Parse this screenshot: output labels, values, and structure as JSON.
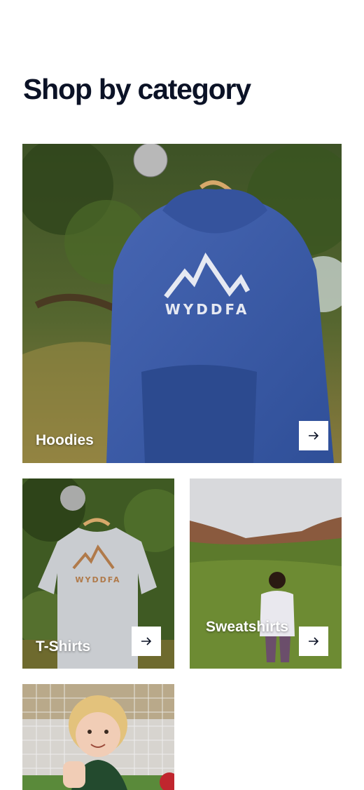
{
  "section": {
    "heading": "Shop by category"
  },
  "categories": [
    {
      "label": "Hoodies",
      "print": "WYDDFA",
      "arrow_icon": "arrow-right-icon"
    },
    {
      "label": "T-Shirts",
      "print": "WYDDFA",
      "arrow_icon": "arrow-right-icon"
    },
    {
      "label": "Sweatshirts",
      "arrow_icon": "arrow-right-icon"
    },
    {
      "label": ""
    }
  ],
  "colors": {
    "heading": "#0b1226",
    "hoodie": "#3b5aa3",
    "tshirt": "#c9ccd0",
    "button_bg": "#ffffff"
  }
}
